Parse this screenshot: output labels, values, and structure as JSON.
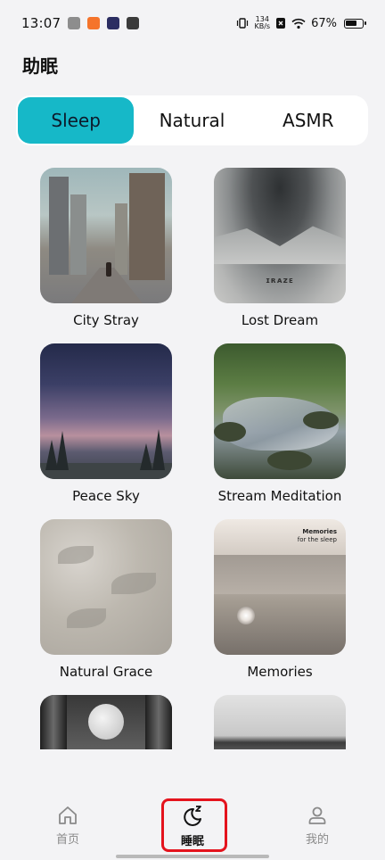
{
  "status_bar": {
    "time": "13:07",
    "speed_top": "134",
    "speed_bottom": "KB/s",
    "battery": "67%"
  },
  "page": {
    "title": "助眠"
  },
  "tabs": [
    {
      "label": "Sleep",
      "active": true
    },
    {
      "label": "Natural",
      "active": false
    },
    {
      "label": "ASMR",
      "active": false
    }
  ],
  "cards": [
    {
      "title": "City Stray",
      "art": "city"
    },
    {
      "title": "Lost Dream",
      "art": "lost"
    },
    {
      "title": "Peace Sky",
      "art": "peace"
    },
    {
      "title": "Stream Meditation",
      "art": "stream"
    },
    {
      "title": "Natural Grace",
      "art": "grace"
    },
    {
      "title": "Memories",
      "art": "memories"
    },
    {
      "title": "",
      "art": "moon"
    },
    {
      "title": "",
      "art": "river"
    }
  ],
  "thumb_text": {
    "lost": "ɪʀᴀᴢᴇ",
    "memories_line1": "Memories",
    "memories_line2": "for the sleep"
  },
  "bottom_nav": [
    {
      "label": "首页",
      "icon": "home-icon",
      "active": false
    },
    {
      "label": "睡眠",
      "icon": "moon-sleep-icon",
      "active": true
    },
    {
      "label": "我的",
      "icon": "profile-icon",
      "active": false
    }
  ],
  "colors": {
    "accent": "#16b8c8",
    "highlight": "#e4131d"
  }
}
